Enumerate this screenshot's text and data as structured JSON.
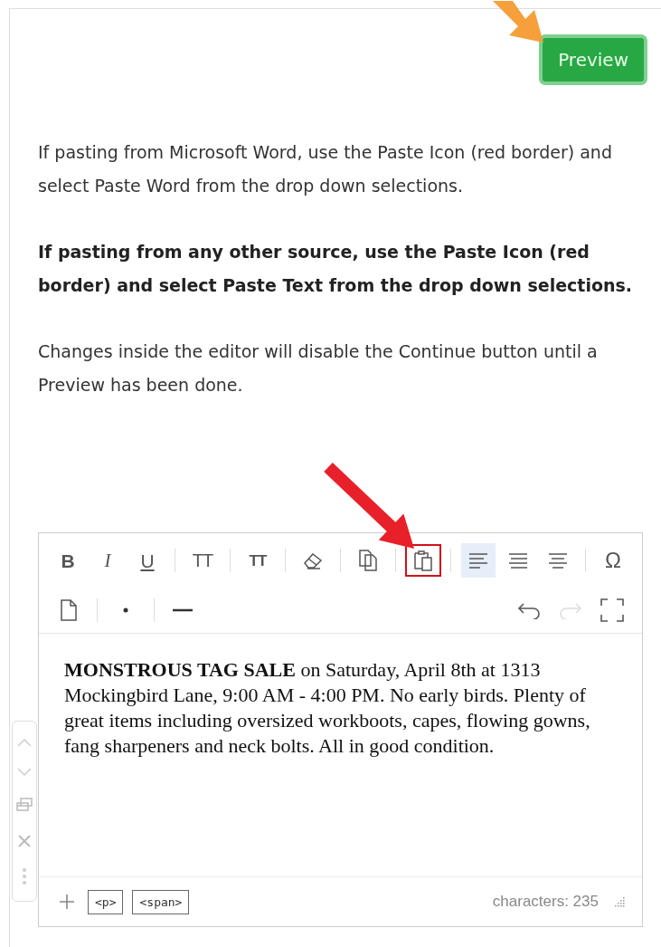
{
  "preview_button": {
    "label": "Preview"
  },
  "instructions": [
    {
      "text": "If pasting from Microsoft Word, use the Paste Icon (red border) and select Paste Word from the drop down selections.",
      "bold": false
    },
    {
      "text": "If pasting from any other source, use the Paste Icon (red border) and select Paste Text from the drop down selections.",
      "bold": true
    },
    {
      "text": "Changes inside the editor will disable the Continue button until a Preview has been done.",
      "bold": false
    }
  ],
  "editor": {
    "toolbar_row_1": [
      {
        "kind": "bold",
        "label": "B",
        "active": false,
        "highlighted": false
      },
      {
        "kind": "italic",
        "label": "I",
        "active": false,
        "highlighted": false
      },
      {
        "kind": "underline",
        "label": "U",
        "active": false,
        "highlighted": false
      },
      {
        "kind": "upper",
        "label": "TT",
        "active": false,
        "highlighted": false
      },
      {
        "kind": "lower",
        "label": "TT",
        "active": false,
        "highlighted": false
      },
      {
        "kind": "eraser",
        "active": false,
        "highlighted": false
      },
      {
        "kind": "copy",
        "active": false,
        "highlighted": false
      },
      {
        "kind": "paste",
        "active": false,
        "highlighted": true
      },
      {
        "kind": "align-left",
        "active": true,
        "highlighted": false
      },
      {
        "kind": "align-justify",
        "active": false,
        "highlighted": false
      },
      {
        "kind": "align-center",
        "active": false,
        "highlighted": false
      },
      {
        "kind": "symbol",
        "label": "Ω",
        "active": false,
        "highlighted": false
      }
    ],
    "toolbar_row_2_left": [
      {
        "kind": "file"
      },
      {
        "kind": "bullet"
      },
      {
        "kind": "hr"
      }
    ],
    "toolbar_row_2_right": [
      {
        "kind": "undo",
        "disabled": false
      },
      {
        "kind": "redo",
        "disabled": true
      },
      {
        "kind": "fullsize",
        "disabled": false
      }
    ],
    "content": "**MONSTROUS TAG SALE** on Saturday, April 8th at 1313 Mockingbird Lane, 9:00 AM - 4:00 PM. No early birds. Plenty of great items including oversized workboots, capes, flowing gowns, fang sharpeners and neck bolts. All in good condition.",
    "path": [
      "<p>",
      "<span>"
    ],
    "character_count": "characters: 235"
  }
}
